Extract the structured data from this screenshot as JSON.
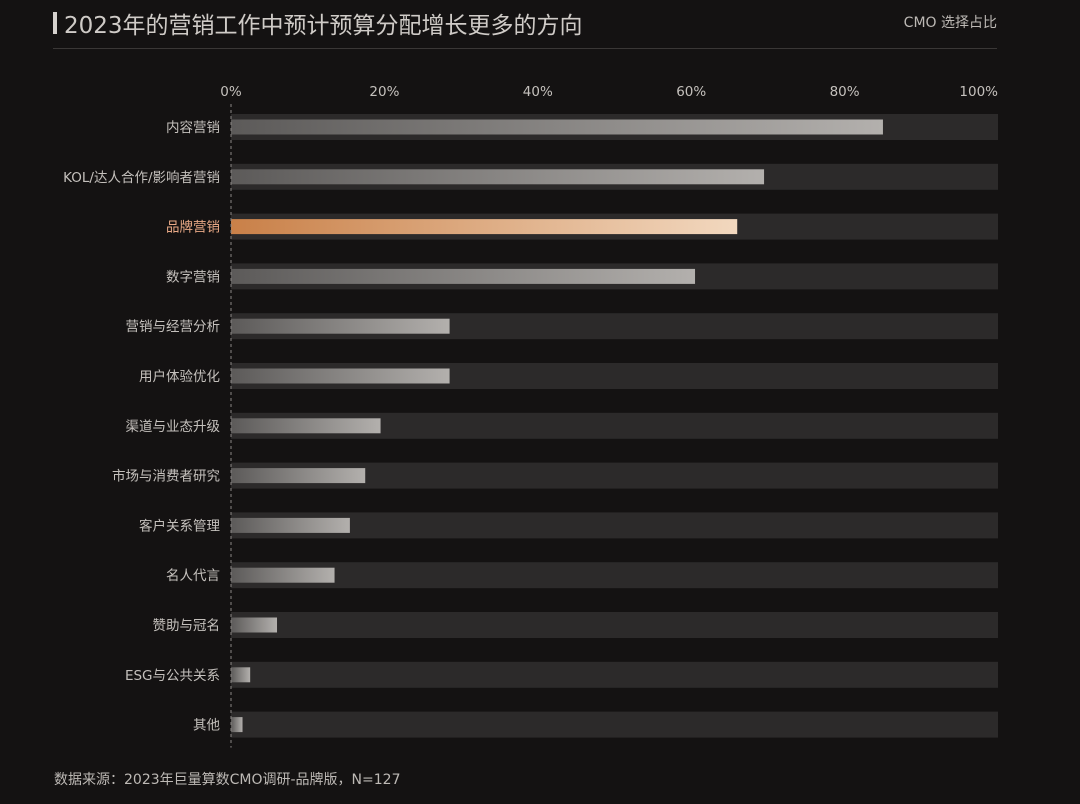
{
  "chart_data": {
    "type": "bar",
    "orientation": "horizontal",
    "title": "2023年的营销工作中预计预算分配增长更多的方向",
    "subtitle": "CMO 选择占比",
    "xlim": [
      0,
      100
    ],
    "x_ticks": [
      "0%",
      "20%",
      "40%",
      "60%",
      "80%",
      "100%"
    ],
    "grid": false,
    "categories": [
      "内容营销",
      "KOL/达人合作/影响者营销",
      "品牌营销",
      "数字营销",
      "营销与经营分析",
      "用户体验优化",
      "渠道与业态升级",
      "市场与消费者研究",
      "客户关系管理",
      "名人代言",
      "赞助与冠名",
      "ESG与公共关系",
      "其他"
    ],
    "values": [
      85,
      69.5,
      66,
      60.5,
      28.5,
      28.5,
      19.5,
      17.5,
      15.5,
      13.5,
      6,
      2.5,
      1.5
    ],
    "highlight_index": 2,
    "colors": {
      "bar_gradient_start": "#5c5a59",
      "bar_gradient_end": "#b3b0ad",
      "highlight_gradient_start": "#c98048",
      "highlight_gradient_end": "#f2d8bf",
      "track": "#2c2a2a",
      "highlight_label": "#e9a986",
      "label": "#c4c0bc"
    }
  },
  "footer": {
    "source": "数据来源：2023年巨量算数CMO调研-品牌版，N=127"
  }
}
